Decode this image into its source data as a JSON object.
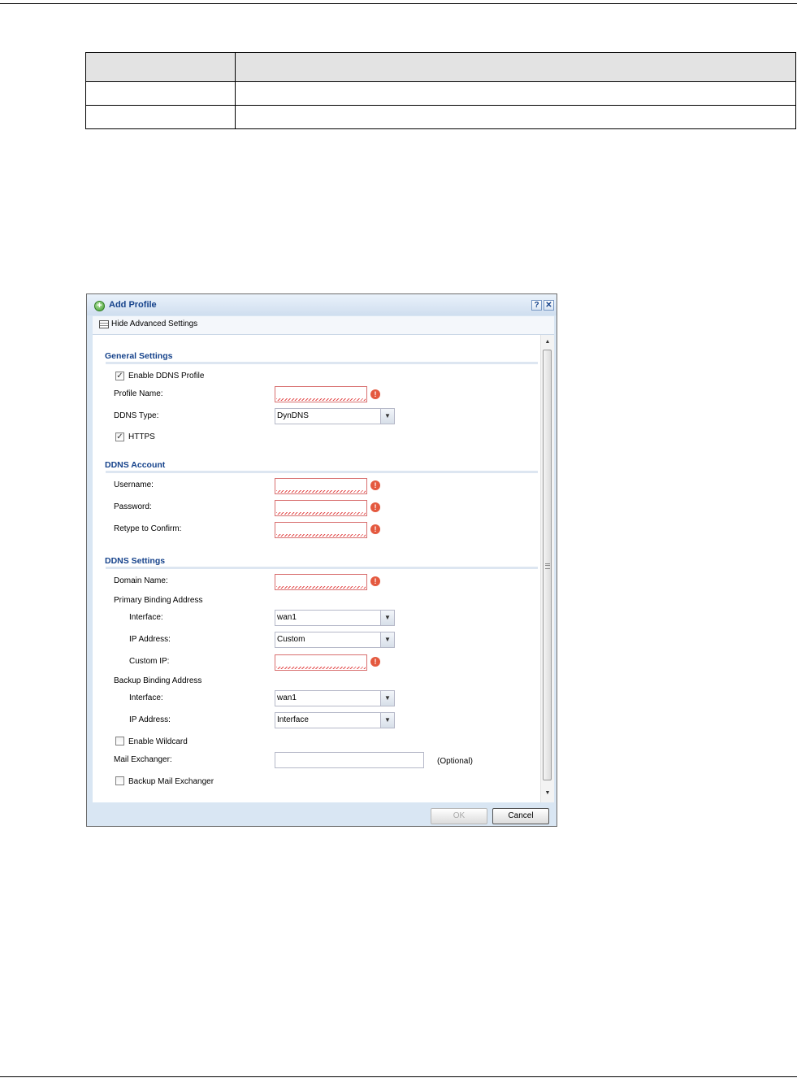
{
  "dialog": {
    "title": "Add Profile",
    "help_glyph": "?",
    "close_glyph": "✕",
    "toolbar_label": "Hide Advanced Settings"
  },
  "general": {
    "title": "General Settings",
    "enable_ddns_label": "Enable DDNS Profile",
    "enable_ddns_checked": true,
    "profile_name_label": "Profile Name:",
    "profile_name_value": "",
    "ddns_type_label": "DDNS Type:",
    "ddns_type_value": "DynDNS",
    "https_label": "HTTPS",
    "https_checked": true
  },
  "account": {
    "title": "DDNS Account",
    "username_label": "Username:",
    "password_label": "Password:",
    "retype_label": "Retype to Confirm:"
  },
  "settings": {
    "title": "DDNS Settings",
    "domain_label": "Domain Name:",
    "primary_label": "Primary Binding Address",
    "primary_interface_label": "Interface:",
    "primary_interface_value": "wan1",
    "primary_ip_label": "IP Address:",
    "primary_ip_value": "Custom",
    "custom_ip_label": "Custom IP:",
    "backup_label": "Backup Binding Address",
    "backup_interface_label": "Interface:",
    "backup_interface_value": "wan1",
    "backup_ip_label": "IP Address:",
    "backup_ip_value": "Interface",
    "wildcard_label": "Enable Wildcard",
    "wildcard_checked": false,
    "mx_label": "Mail Exchanger:",
    "mx_optional": "(Optional)",
    "backup_mx_label": "Backup Mail Exchanger",
    "backup_mx_checked": false
  },
  "error_glyph": "!",
  "check_glyph": "✓",
  "dropdown_glyph": "▼",
  "buttons": {
    "ok": "OK",
    "cancel": "Cancel"
  },
  "colors": {
    "title": "#15428b",
    "error": "#e4593f",
    "dialog_bg": "#d9e6f3"
  }
}
